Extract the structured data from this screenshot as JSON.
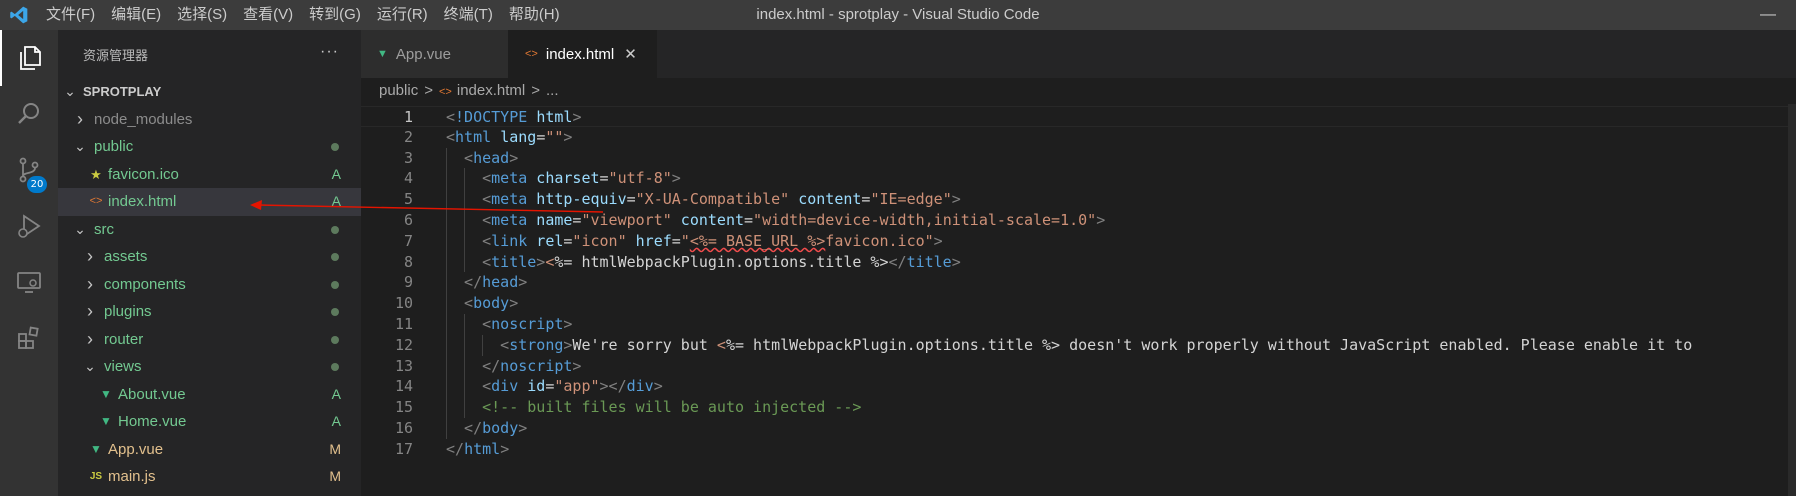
{
  "title_bar": {
    "menus": [
      "文件(F)",
      "编辑(E)",
      "选择(S)",
      "查看(V)",
      "转到(G)",
      "运行(R)",
      "终端(T)",
      "帮助(H)"
    ],
    "window_title": "index.html - sprotplay - Visual Studio Code"
  },
  "activity_bar": {
    "items": [
      "explorer-icon",
      "search-icon",
      "source-control-icon",
      "run-debug-icon",
      "remote-explorer-icon",
      "extensions-icon"
    ],
    "scm_badge": "20"
  },
  "sidebar": {
    "title": "资源管理器",
    "more": "···",
    "project": "SPROTPLAY",
    "tree": [
      {
        "label": "node_modules",
        "type": "folder",
        "open": false,
        "depth": 1,
        "decoration": "",
        "dot": false
      },
      {
        "label": "public",
        "type": "folder",
        "open": true,
        "depth": 1,
        "decoration": "",
        "dot": true
      },
      {
        "label": "favicon.ico",
        "type": "file",
        "icon": "star",
        "depth": 2,
        "decoration": "A"
      },
      {
        "label": "index.html",
        "type": "file",
        "icon": "html",
        "depth": 2,
        "decoration": "A",
        "selected": true
      },
      {
        "label": "src",
        "type": "folder",
        "open": true,
        "depth": 1,
        "decoration": "",
        "dot": true
      },
      {
        "label": "assets",
        "type": "folder",
        "open": false,
        "depth": 2,
        "decoration": "",
        "dot": true
      },
      {
        "label": "components",
        "type": "folder",
        "open": false,
        "depth": 2,
        "decoration": "",
        "dot": true
      },
      {
        "label": "plugins",
        "type": "folder",
        "open": false,
        "depth": 2,
        "decoration": "",
        "dot": true
      },
      {
        "label": "router",
        "type": "folder",
        "open": false,
        "depth": 2,
        "decoration": "",
        "dot": true
      },
      {
        "label": "views",
        "type": "folder",
        "open": true,
        "depth": 2,
        "decoration": "",
        "dot": true
      },
      {
        "label": "About.vue",
        "type": "file",
        "icon": "vue",
        "depth": 3,
        "decoration": "A"
      },
      {
        "label": "Home.vue",
        "type": "file",
        "icon": "vue",
        "depth": 3,
        "decoration": "A"
      },
      {
        "label": "App.vue",
        "type": "file",
        "icon": "vue",
        "depth": 2,
        "decoration": "M"
      },
      {
        "label": "main.js",
        "type": "file",
        "icon": "js",
        "depth": 2,
        "decoration": "M"
      }
    ]
  },
  "tabs": [
    {
      "label": "App.vue",
      "icon": "vue",
      "active": false
    },
    {
      "label": "index.html",
      "icon": "html",
      "active": true,
      "close": "✕"
    }
  ],
  "breadcrumb": [
    "public",
    ">",
    "index.html",
    ">",
    "..."
  ],
  "editor": {
    "current_line": 1,
    "lines": [
      {
        "n": "1",
        "indent": 0,
        "tokens": [
          [
            "br",
            "<"
          ],
          [
            "tag",
            "!DOCTYPE"
          ],
          [
            "txt",
            " "
          ],
          [
            "attr",
            "html"
          ],
          [
            "br",
            ">"
          ]
        ]
      },
      {
        "n": "2",
        "indent": 0,
        "tokens": [
          [
            "br",
            "<"
          ],
          [
            "tag",
            "html"
          ],
          [
            "txt",
            " "
          ],
          [
            "attr",
            "lang"
          ],
          [
            "txt",
            "="
          ],
          [
            "str",
            "\"\""
          ],
          [
            "br",
            ">"
          ]
        ]
      },
      {
        "n": "3",
        "indent": 1,
        "tokens": [
          [
            "br",
            "<"
          ],
          [
            "tag",
            "head"
          ],
          [
            "br",
            ">"
          ]
        ]
      },
      {
        "n": "4",
        "indent": 2,
        "tokens": [
          [
            "br",
            "<"
          ],
          [
            "tag",
            "meta"
          ],
          [
            "txt",
            " "
          ],
          [
            "attr",
            "charset"
          ],
          [
            "txt",
            "="
          ],
          [
            "str",
            "\"utf-8\""
          ],
          [
            "br",
            ">"
          ]
        ]
      },
      {
        "n": "5",
        "indent": 2,
        "tokens": [
          [
            "br",
            "<"
          ],
          [
            "tag",
            "meta"
          ],
          [
            "txt",
            " "
          ],
          [
            "attr",
            "http-equiv"
          ],
          [
            "txt",
            "="
          ],
          [
            "str",
            "\"X-UA-Compatible\""
          ],
          [
            "txt",
            " "
          ],
          [
            "attr",
            "content"
          ],
          [
            "txt",
            "="
          ],
          [
            "str",
            "\"IE=edge\""
          ],
          [
            "br",
            ">"
          ]
        ]
      },
      {
        "n": "6",
        "indent": 2,
        "tokens": [
          [
            "br",
            "<"
          ],
          [
            "tag",
            "meta"
          ],
          [
            "txt",
            " "
          ],
          [
            "attr",
            "name"
          ],
          [
            "txt",
            "="
          ],
          [
            "str",
            "\"viewport\""
          ],
          [
            "txt",
            " "
          ],
          [
            "attr",
            "content"
          ],
          [
            "txt",
            "="
          ],
          [
            "str",
            "\"width=device-width,initial-scale=1.0\""
          ],
          [
            "br",
            ">"
          ]
        ]
      },
      {
        "n": "7",
        "indent": 2,
        "tokens": [
          [
            "br",
            "<"
          ],
          [
            "tag",
            "link"
          ],
          [
            "txt",
            " "
          ],
          [
            "attr",
            "rel"
          ],
          [
            "txt",
            "="
          ],
          [
            "str",
            "\"icon\""
          ],
          [
            "txt",
            " "
          ],
          [
            "attr",
            "href"
          ],
          [
            "txt",
            "="
          ],
          [
            "str",
            "\""
          ],
          [
            "tpl",
            "<%= BASE_URL %>"
          ],
          [
            "str",
            "favicon.ico\""
          ],
          [
            "br",
            ">"
          ]
        ]
      },
      {
        "n": "8",
        "indent": 2,
        "tokens": [
          [
            "br",
            "<"
          ],
          [
            "tag",
            "title"
          ],
          [
            "br",
            ">"
          ],
          [
            "str",
            "<"
          ],
          [
            "txt",
            "%= htmlWebpackPlugin.options.title %>"
          ],
          [
            "br",
            "</"
          ],
          [
            "tag",
            "title"
          ],
          [
            "br",
            ">"
          ]
        ]
      },
      {
        "n": "9",
        "indent": 1,
        "tokens": [
          [
            "br",
            "</"
          ],
          [
            "tag",
            "head"
          ],
          [
            "br",
            ">"
          ]
        ]
      },
      {
        "n": "10",
        "indent": 1,
        "tokens": [
          [
            "br",
            "<"
          ],
          [
            "tag",
            "body"
          ],
          [
            "br",
            ">"
          ]
        ]
      },
      {
        "n": "11",
        "indent": 2,
        "tokens": [
          [
            "br",
            "<"
          ],
          [
            "tag",
            "noscript"
          ],
          [
            "br",
            ">"
          ]
        ]
      },
      {
        "n": "12",
        "indent": 3,
        "tokens": [
          [
            "br",
            "<"
          ],
          [
            "tag",
            "strong"
          ],
          [
            "br",
            ">"
          ],
          [
            "txt",
            "We're sorry but "
          ],
          [
            "str",
            "<"
          ],
          [
            "txt",
            "%= htmlWebpackPlugin.options.title %> doesn't work properly without JavaScript enabled. Please enable it to"
          ]
        ]
      },
      {
        "n": "13",
        "indent": 2,
        "tokens": [
          [
            "br",
            "</"
          ],
          [
            "tag",
            "noscript"
          ],
          [
            "br",
            ">"
          ]
        ]
      },
      {
        "n": "14",
        "indent": 2,
        "tokens": [
          [
            "br",
            "<"
          ],
          [
            "tag",
            "div"
          ],
          [
            "txt",
            " "
          ],
          [
            "attr",
            "id"
          ],
          [
            "txt",
            "="
          ],
          [
            "str",
            "\"app\""
          ],
          [
            "br",
            "></"
          ],
          [
            "tag",
            "div"
          ],
          [
            "br",
            ">"
          ]
        ]
      },
      {
        "n": "15",
        "indent": 2,
        "tokens": [
          [
            "com",
            "<!-- built files will be auto injected -->"
          ]
        ]
      },
      {
        "n": "16",
        "indent": 1,
        "tokens": [
          [
            "br",
            "</"
          ],
          [
            "tag",
            "body"
          ],
          [
            "br",
            ">"
          ]
        ]
      },
      {
        "n": "17",
        "indent": 0,
        "tokens": [
          [
            "br",
            "</"
          ],
          [
            "tag",
            "html"
          ],
          [
            "br",
            ">"
          ]
        ]
      }
    ]
  },
  "colors": {
    "accent": "#007acc",
    "added": "#73c991",
    "modified": "#e2c08d",
    "annotation_arrow": "#e51400"
  }
}
